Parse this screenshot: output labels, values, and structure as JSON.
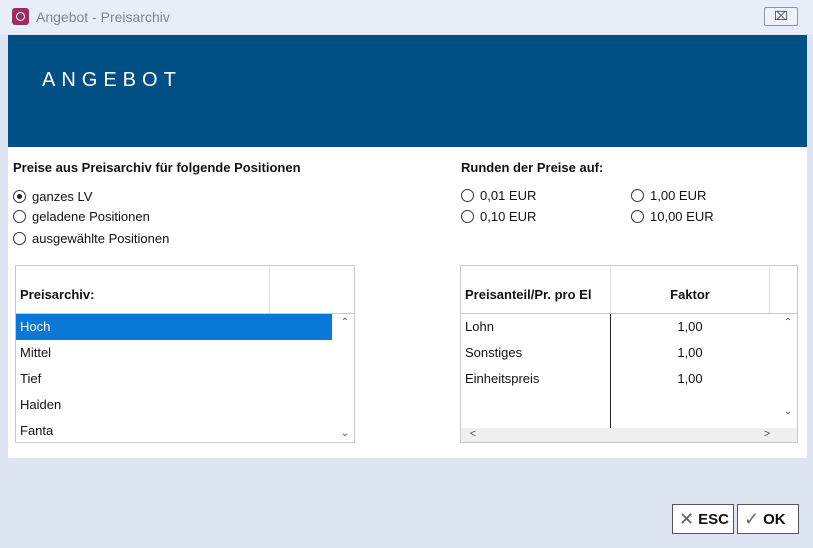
{
  "window": {
    "title": "Angebot - Preisarchiv",
    "close_label": "⌧"
  },
  "banner": {
    "title": "ANGEBOT"
  },
  "scope": {
    "title": "Preise aus Preisarchiv für folgende Positionen",
    "options": [
      {
        "label": "ganzes LV",
        "checked": true
      },
      {
        "label": "geladene Positionen",
        "checked": false
      },
      {
        "label": "ausgewählte Positionen",
        "checked": false
      }
    ]
  },
  "rounding": {
    "title": "Runden der Preise auf:",
    "options": [
      {
        "label": "0,01 EUR",
        "checked": false
      },
      {
        "label": "0,10 EUR",
        "checked": false
      },
      {
        "label": "1,00 EUR",
        "checked": false
      },
      {
        "label": "10,00 EUR",
        "checked": false
      }
    ]
  },
  "archive": {
    "header": "Preisarchiv:",
    "items": [
      "Hoch",
      "Mittel",
      "Tief",
      "Haiden",
      "Fanta"
    ],
    "selected_index": 0
  },
  "factor_grid": {
    "columns": [
      "Preisanteil/Pr. pro El",
      "Faktor"
    ],
    "rows": [
      {
        "name": "Lohn",
        "factor": "1,00"
      },
      {
        "name": "Sonstiges",
        "factor": "1,00"
      },
      {
        "name": "Einheitspreis",
        "factor": "1,00"
      }
    ]
  },
  "buttons": {
    "esc_label": "ESC",
    "ok_label": "OK"
  },
  "colors": {
    "banner": "#004f85",
    "selection": "#0a78d7"
  }
}
